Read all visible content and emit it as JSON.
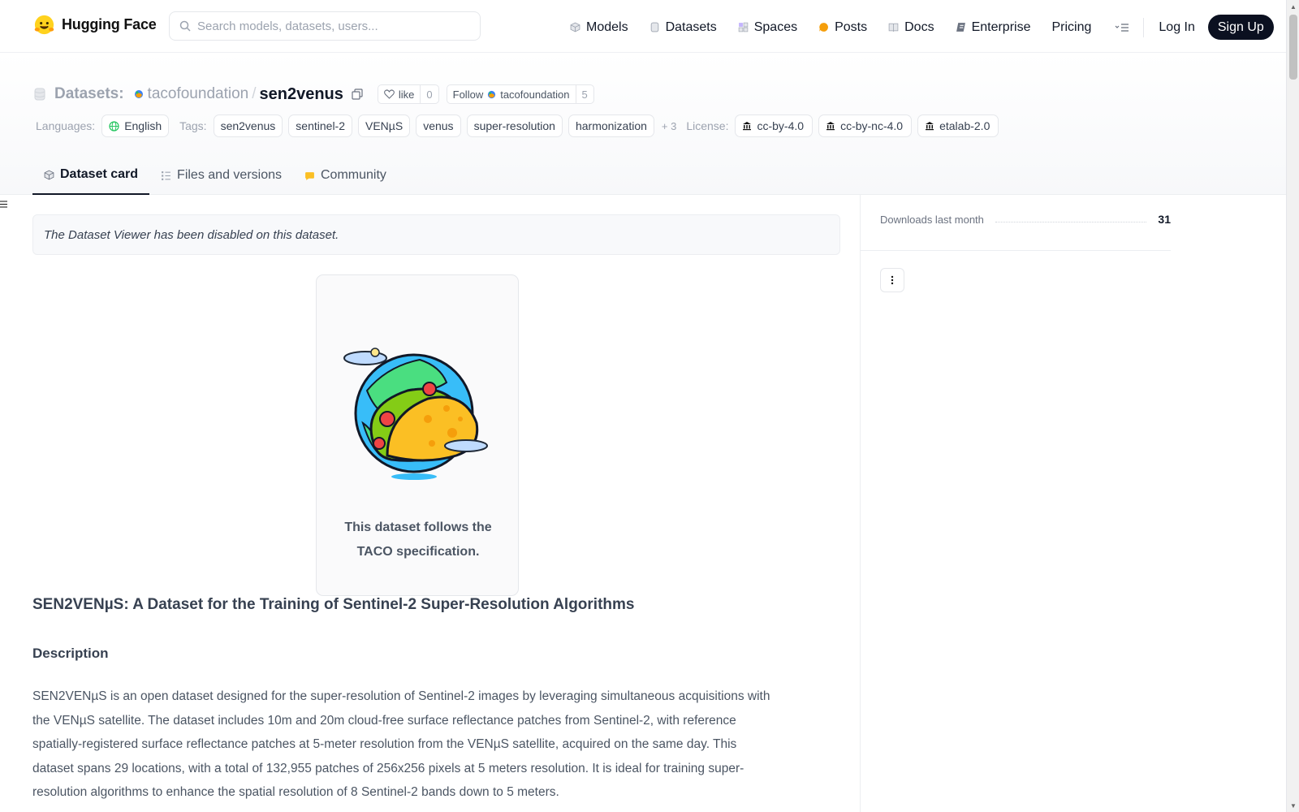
{
  "topnav": {
    "brand": "Hugging Face",
    "search_placeholder": "Search models, datasets, users...",
    "links": [
      {
        "label": "Models",
        "icon": "cube-icon",
        "color": "#6b7280"
      },
      {
        "label": "Datasets",
        "icon": "database-icon",
        "color": "#6b7280"
      },
      {
        "label": "Spaces",
        "icon": "grid-icon",
        "color": "#6b7280"
      },
      {
        "label": "Posts",
        "icon": "chat-bubble-icon",
        "color": "#f59e0b"
      },
      {
        "label": "Docs",
        "icon": "book-icon",
        "color": "#6b7280"
      },
      {
        "label": "Enterprise",
        "icon": "enterprise-icon",
        "color": "#6b7280"
      },
      {
        "label": "Pricing"
      }
    ],
    "login": "Log In",
    "signup": "Sign Up"
  },
  "header": {
    "section": "Datasets:",
    "org": "tacofoundation",
    "separator": "/",
    "name": "sen2venus",
    "like_label": "like",
    "like_count": "0",
    "follow_label": "Follow",
    "follow_org": "tacofoundation",
    "follow_count": "5"
  },
  "tags": {
    "languages_label": "Languages:",
    "language": "English",
    "tags_label": "Tags:",
    "items": [
      "sen2venus",
      "sentinel-2",
      "VENµS",
      "venus",
      "super-resolution",
      "harmonization"
    ],
    "more": "+ 3",
    "license_label": "License:",
    "licenses": [
      "cc-by-4.0",
      "cc-by-nc-4.0",
      "etalab-2.0"
    ]
  },
  "tabs": [
    {
      "label": "Dataset card",
      "icon": "cube-icon",
      "active": true
    },
    {
      "label": "Files and versions",
      "icon": "files-icon"
    },
    {
      "label": "Community",
      "icon": "community-icon"
    }
  ],
  "main": {
    "viewer_note": "The Dataset Viewer has been disabled on this dataset.",
    "taco_caption_line1": "This dataset follows the",
    "taco_caption_line2": "TACO specification.",
    "title": "SEN2VENµS: A Dataset for the Training of Sentinel-2 Super-Resolution Algorithms",
    "description_heading": "Description",
    "description_lines": [
      "SEN2VENµS is an open dataset designed for the super-resolution of Sentinel-2 images by leveraging simultaneous acquisitions with",
      "the VENµS satellite. The dataset includes 10m and 20m cloud-free surface reflectance patches from Sentinel-2, with reference",
      "spatially-registered surface reflectance patches at 5-meter resolution from the VENµS satellite, acquired on the same day. This",
      "dataset spans 29 locations, with a total of 132,955 patches of 256x256 pixels at 5 meters resolution. It is ideal for training super-",
      "resolution algorithms to enhance the spatial resolution of 8 Sentinel-2 bands down to 5 meters."
    ]
  },
  "sidebar": {
    "downloads_label": "Downloads last month",
    "downloads_value": "31"
  },
  "colors": {
    "accent_dark": "#0b1020",
    "muted_text": "#9ca3af",
    "border": "#e5e7eb"
  }
}
